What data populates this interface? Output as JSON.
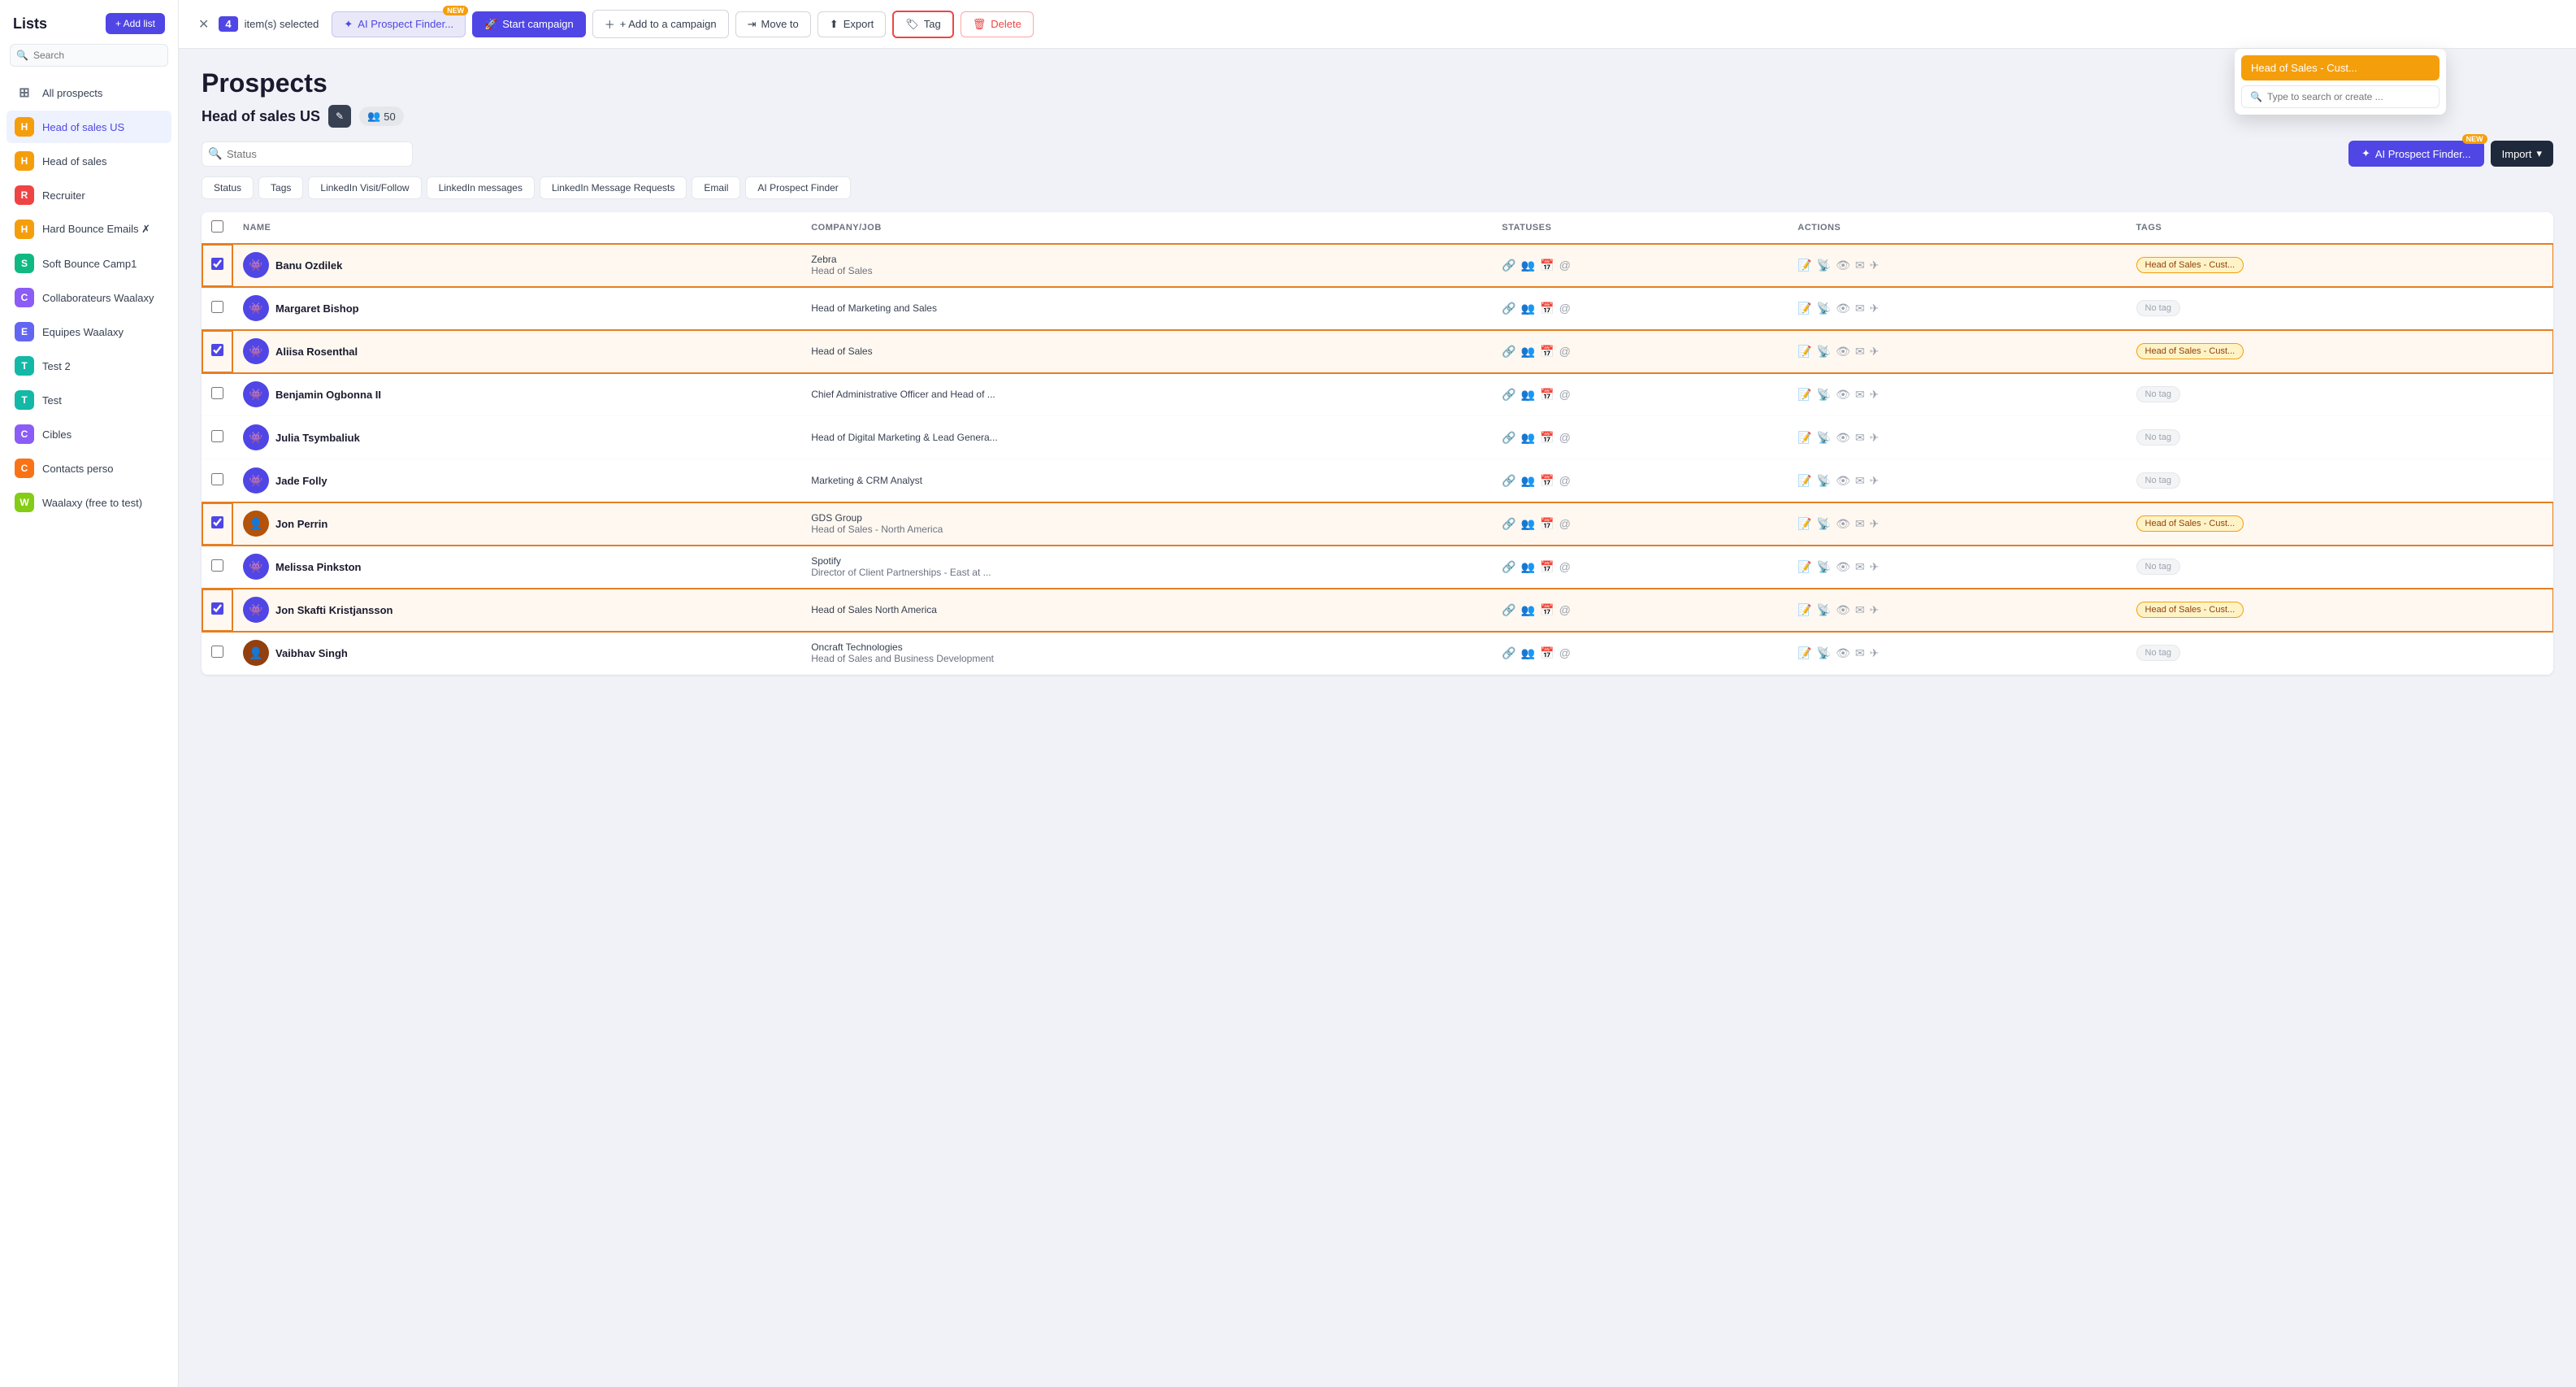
{
  "sidebar": {
    "title": "Lists",
    "add_list_label": "+ Add list",
    "search_placeholder": "Search",
    "items": [
      {
        "id": "all-prospects",
        "label": "All prospects",
        "color": "",
        "icon": "⊞",
        "type": "all"
      },
      {
        "id": "head-of-sales-us",
        "label": "Head of sales US",
        "color": "#f59e0b",
        "initial": "H",
        "active": true
      },
      {
        "id": "head-of-sales",
        "label": "Head of sales",
        "color": "#f59e0b",
        "initial": "H"
      },
      {
        "id": "recruiter",
        "label": "Recruiter",
        "color": "#ef4444",
        "initial": "R"
      },
      {
        "id": "hard-bounce-emails",
        "label": "Hard Bounce Emails ✗",
        "color": "#f59e0b",
        "initial": "H"
      },
      {
        "id": "soft-bounce-camp1",
        "label": "Soft Bounce Camp1",
        "color": "#10b981",
        "initial": "S"
      },
      {
        "id": "collaborateurs-waalaxy",
        "label": "Collaborateurs Waalaxy",
        "color": "#8b5cf6",
        "initial": "C"
      },
      {
        "id": "equipes-waalaxy",
        "label": "Equipes Waalaxy",
        "color": "#6366f1",
        "initial": "E"
      },
      {
        "id": "test-2",
        "label": "Test 2",
        "color": "#14b8a6",
        "initial": "T"
      },
      {
        "id": "test",
        "label": "Test",
        "color": "#14b8a6",
        "initial": "T"
      },
      {
        "id": "cibles",
        "label": "Cibles",
        "color": "#8b5cf6",
        "initial": "C"
      },
      {
        "id": "contacts-perso",
        "label": "Contacts perso",
        "color": "#f97316",
        "initial": "C"
      },
      {
        "id": "waalaxy-free",
        "label": "Waalaxy (free to test)",
        "color": "#84cc16",
        "initial": "W"
      }
    ]
  },
  "toolbar": {
    "selected_count": "4",
    "selected_text": "item(s) selected",
    "ai_prospect_label": "AI Prospect Finder...",
    "ai_new_badge": "NEW",
    "start_campaign_label": "Start campaign",
    "add_campaign_label": "+ Add to a campaign",
    "move_to_label": "Move to",
    "export_label": "Export",
    "tag_label": "Tag",
    "delete_label": "Delete"
  },
  "page": {
    "title": "Prospects",
    "subtitle": "Head of sales US",
    "count": "50",
    "count_icon": "👥"
  },
  "filter_tabs": [
    {
      "label": "Status",
      "active": false
    },
    {
      "label": "Tags",
      "active": false
    },
    {
      "label": "LinkedIn Visit/Follow",
      "active": false
    },
    {
      "label": "LinkedIn messages",
      "active": false
    },
    {
      "label": "LinkedIn Message Requests",
      "active": false
    },
    {
      "label": "Email",
      "active": false
    },
    {
      "label": "AI Prospect Finder",
      "active": false
    }
  ],
  "table": {
    "columns": [
      "NAME",
      "COMPANY/JOB",
      "STATUSES",
      "ACTIONS",
      "TAGS"
    ],
    "rows": [
      {
        "id": 1,
        "selected": true,
        "name": "Banu Ozdilek",
        "company": "Zebra",
        "job": "Head of Sales",
        "avatar_color": "#4f46e5",
        "tag": "Head of Sales - Cust...",
        "tag_type": "yellow"
      },
      {
        "id": 2,
        "selected": false,
        "name": "Margaret Bishop",
        "company": "",
        "job": "Head of Marketing and Sales",
        "avatar_color": "#4f46e5",
        "tag": "No tag",
        "tag_type": "empty"
      },
      {
        "id": 3,
        "selected": true,
        "name": "Aliisa Rosenthal",
        "company": "",
        "job": "Head of Sales",
        "avatar_color": "#4f46e5",
        "tag": "Head of Sales - Cust...",
        "tag_type": "yellow"
      },
      {
        "id": 4,
        "selected": false,
        "name": "Benjamin Ogbonna II",
        "company": "",
        "job": "Chief Administrative Officer and Head of ...",
        "avatar_color": "#4f46e5",
        "tag": "No tag",
        "tag_type": "empty"
      },
      {
        "id": 5,
        "selected": false,
        "name": "Julia Tsymbaliuk",
        "company": "",
        "job": "Head of Digital Marketing & Lead Genera...",
        "avatar_color": "#4f46e5",
        "tag": "No tag",
        "tag_type": "empty"
      },
      {
        "id": 6,
        "selected": false,
        "name": "Jade Folly",
        "company": "",
        "job": "Marketing & CRM Analyst",
        "avatar_color": "#4f46e5",
        "tag": "No tag",
        "tag_type": "empty"
      },
      {
        "id": 7,
        "selected": true,
        "name": "Jon Perrin",
        "company": "GDS Group",
        "job": "Head of Sales - North America",
        "avatar_color": "#b45309",
        "has_photo": true,
        "tag": "Head of Sales - Cust...",
        "tag_type": "yellow"
      },
      {
        "id": 8,
        "selected": false,
        "name": "Melissa Pinkston",
        "company": "Spotify",
        "job": "Director of Client Partnerships - East at ...",
        "avatar_color": "#4f46e5",
        "tag": "No tag",
        "tag_type": "empty"
      },
      {
        "id": 9,
        "selected": true,
        "name": "Jon Skafti Kristjansson",
        "company": "",
        "job": "Head of Sales North America",
        "avatar_color": "#4f46e5",
        "tag": "Head of Sales - Cust...",
        "tag_type": "yellow"
      },
      {
        "id": 10,
        "selected": false,
        "name": "Vaibhav Singh",
        "company": "Oncraft Technologies",
        "job": "Head of Sales and Business Development",
        "avatar_color": "#92400e",
        "has_photo": true,
        "tag": "No tag",
        "tag_type": "empty"
      }
    ]
  },
  "tag_dropdown": {
    "existing_tag": "Head of Sales - Cust...",
    "search_placeholder": "Type to search or create ..."
  },
  "ai_finder": {
    "label": "AI Prospect Finder...",
    "new_badge": "NEW"
  },
  "import_label": "Import"
}
